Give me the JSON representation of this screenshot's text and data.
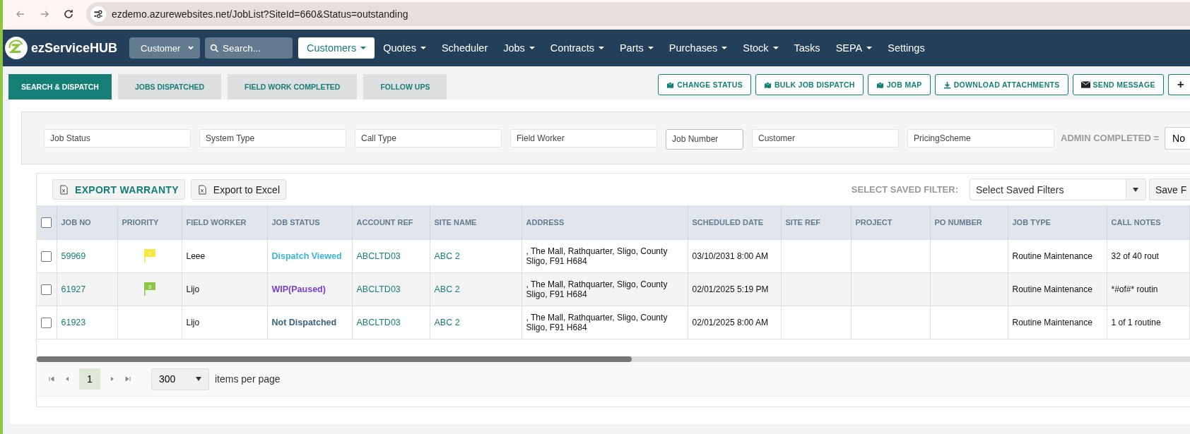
{
  "browser": {
    "url": "ezdemo.azurewebsites.net/JobList?SiteId=660&Status=outstanding"
  },
  "nav": {
    "brand": "ezServiceHUB",
    "search_type": "Customer",
    "search_placeholder": "Search...",
    "items": [
      {
        "label": "Customers",
        "dropdown": true,
        "selected": true
      },
      {
        "label": "Quotes",
        "dropdown": true,
        "selected": false
      },
      {
        "label": "Scheduler",
        "dropdown": false,
        "selected": false
      },
      {
        "label": "Jobs",
        "dropdown": true,
        "selected": false
      },
      {
        "label": "Contracts",
        "dropdown": true,
        "selected": false
      },
      {
        "label": "Parts",
        "dropdown": true,
        "selected": false
      },
      {
        "label": "Purchases",
        "dropdown": true,
        "selected": false
      },
      {
        "label": "Stock",
        "dropdown": true,
        "selected": false
      },
      {
        "label": "Tasks",
        "dropdown": false,
        "selected": false
      },
      {
        "label": "SEPA",
        "dropdown": true,
        "selected": false
      },
      {
        "label": "Settings",
        "dropdown": false,
        "selected": false
      }
    ]
  },
  "tabs": [
    {
      "label": "SEARCH & DISPATCH",
      "selected": true
    },
    {
      "label": "JOBS DISPATCHED",
      "selected": false
    },
    {
      "label": "FIELD WORK COMPLETED",
      "selected": false
    },
    {
      "label": "FOLLOW UPS",
      "selected": false
    }
  ],
  "actions": [
    {
      "label": "CHANGE STATUS",
      "kind": "map"
    },
    {
      "label": "BULK JOB DISPATCH",
      "kind": "map"
    },
    {
      "label": "JOB MAP",
      "kind": "map"
    },
    {
      "label": "DOWNLOAD ATTACHMENTS",
      "kind": "download"
    },
    {
      "label": "SEND MESSAGE",
      "kind": "mail"
    },
    {
      "label": "+",
      "kind": "plain"
    }
  ],
  "filters": [
    {
      "placeholder": "Job Status",
      "kind": "wide"
    },
    {
      "placeholder": "System Type",
      "kind": "wide"
    },
    {
      "placeholder": "Call Type",
      "kind": "wide"
    },
    {
      "placeholder": "Field Worker",
      "kind": "wide"
    },
    {
      "placeholder": "Job Number",
      "kind": "narrow"
    },
    {
      "placeholder": "Customer",
      "kind": "wide"
    },
    {
      "placeholder": "PricingScheme",
      "kind": "wide"
    }
  ],
  "admin_completed": {
    "label": "ADMIN COMPLETED =",
    "value": "No"
  },
  "toolbar": {
    "export_warranty": "EXPORT WARRANTY",
    "export_excel": "Export to Excel",
    "saved_filter_label": "SELECT SAVED FILTER:",
    "saved_filter_placeholder": "Select Saved Filters",
    "save_button": "Save F"
  },
  "table": {
    "select_all_checked": false,
    "columns": [
      "JOB NO",
      "PRIORITY",
      "FIELD WORKER",
      "JOB STATUS",
      "ACCOUNT REF",
      "SITE NAME",
      "ADDRESS",
      "SCHEDULED DATE",
      "SITE REF",
      "PROJECT",
      "PO NUMBER",
      "JOB TYPE",
      "CALL NOTES"
    ],
    "rows": [
      {
        "checked": false,
        "job_no": "59969",
        "priority": {
          "label": "0",
          "color": "#f5e83a"
        },
        "field_worker": "Leee",
        "job_status": {
          "text": "Dispatch Viewed",
          "color": "#3bb4d6"
        },
        "account_ref": "ABCLTD03",
        "site_name": "ABC 2",
        "address": ", The Mall, Rathquarter, Sligo, County Sligo, F91 H684",
        "scheduled_date": "03/10/2031 8:00 AM",
        "job_type": "Routine Maintenance",
        "call_notes": "32 of 40 rout"
      },
      {
        "checked": false,
        "job_no": "61927",
        "priority": {
          "label": "3",
          "color": "#8cc43f"
        },
        "field_worker": "Lijo",
        "job_status": {
          "text": "WIP(Paused)",
          "color": "#7b3fd0"
        },
        "account_ref": "ABCLTD03",
        "site_name": "ABC 2",
        "address": ", The Mall, Rathquarter, Sligo, County Sligo, F91 H684",
        "scheduled_date": "02/01/2025 5:19 PM",
        "job_type": "Routine Maintenance",
        "call_notes": "*#of#* routin"
      },
      {
        "checked": false,
        "job_no": "61923",
        "priority": null,
        "field_worker": "Lijo",
        "job_status": {
          "text": "Not Dispatched",
          "color": "#3a6187"
        },
        "account_ref": "ABCLTD03",
        "site_name": "ABC 2",
        "address": ", The Mall, Rathquarter, Sligo, County Sligo, F91 H684",
        "scheduled_date": "02/01/2025 8:00 AM",
        "job_type": "Routine Maintenance",
        "call_notes": "1 of 1 routine"
      }
    ]
  },
  "pager": {
    "current": "1",
    "page_size": "300",
    "label": "items per page"
  }
}
